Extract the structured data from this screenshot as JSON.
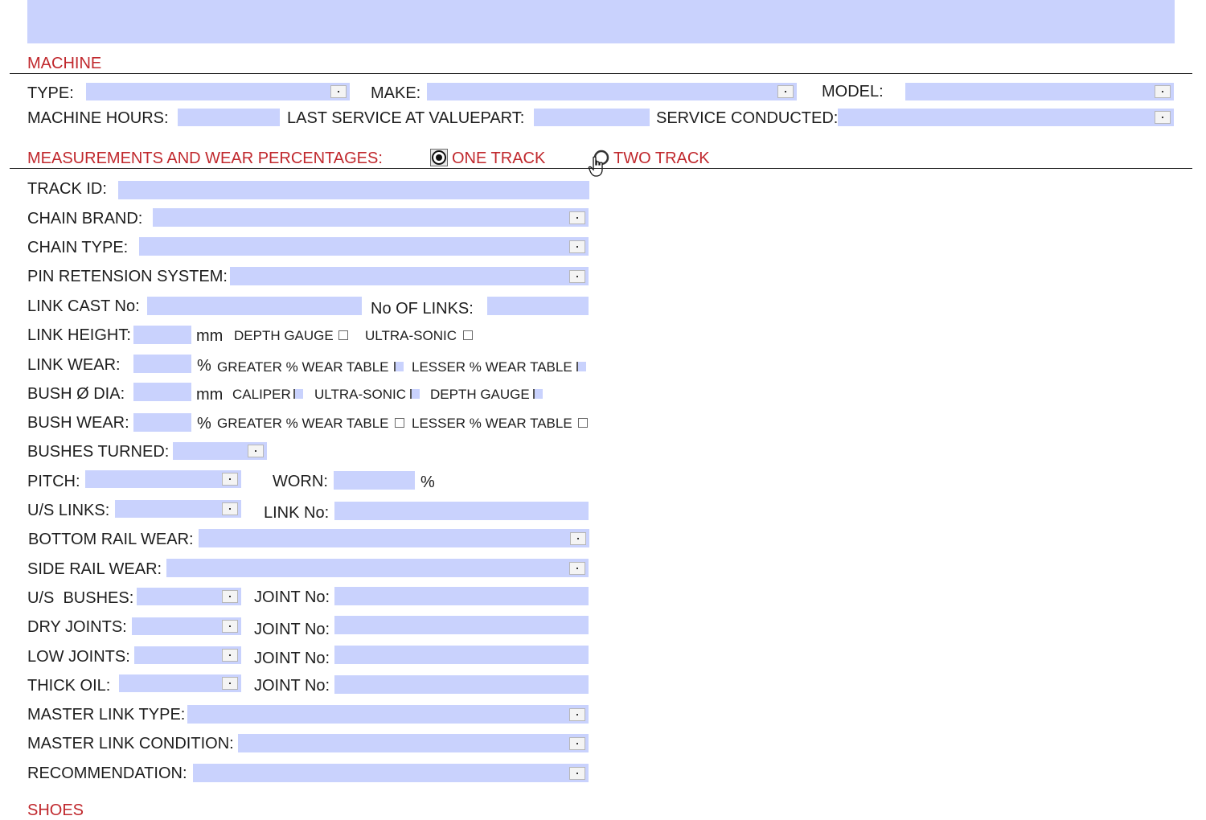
{
  "sections": {
    "machine": "MACHINE",
    "measurements": "MEASUREMENTS AND WEAR PERCENTAGES:",
    "shoes": "SHOES"
  },
  "machine": {
    "type_label": "TYPE:",
    "make_label": "MAKE:",
    "model_label": "MODEL:",
    "hours_label": "MACHINE HOURS:",
    "last_service_label": "LAST SERVICE AT VALUEPART:",
    "service_conducted_label": "SERVICE CONDUCTED:"
  },
  "track_mode": {
    "one_track": "ONE TRACK",
    "two_track": "TWO TRACK",
    "selected": "ONE TRACK"
  },
  "fields": {
    "track_id": "TRACK ID:",
    "chain_brand": "CHAIN BRAND:",
    "chain_type": "CHAIN TYPE:",
    "pin_retension": "PIN RETENSION SYSTEM:",
    "link_cast_no": "LINK CAST No:",
    "no_of_links": "No OF LINKS:",
    "link_height": "LINK HEIGHT:",
    "link_wear": "LINK WEAR:",
    "bush_dia": "BUSH Ø DIA:",
    "bush_wear": "BUSH WEAR:",
    "bushes_turned": "BUSHES TURNED:",
    "pitch": "PITCH:",
    "worn": "WORN:",
    "us_links": "U/S LINKS:",
    "link_no": "LINK No:",
    "bottom_rail_wear": "BOTTOM RAIL WEAR:",
    "side_rail_wear": "SIDE RAIL WEAR:",
    "us_bushes": "U/S  BUSHES:",
    "dry_joints": "DRY JOINTS:",
    "low_joints": "LOW JOINTS:",
    "thick_oil": "THICK OIL:",
    "joint_no": "JOINT No:",
    "master_link_type": "MASTER LINK TYPE:",
    "master_link_condition": "MASTER LINK CONDITION:",
    "recommendation": "RECOMMENDATION:"
  },
  "units": {
    "mm": "mm",
    "percent": "%"
  },
  "options": {
    "depth_gauge": "DEPTH GAUGE",
    "ultra_sonic": "ULTRA-SONIC",
    "caliper": "CALIPER",
    "greater_wear_table": "GREATER % WEAR TABLE",
    "lesser_wear_table": "LESSER % WEAR TABLE"
  },
  "colors": {
    "field_fill": "#c9d2fd",
    "section_heading": "#c0282d"
  }
}
